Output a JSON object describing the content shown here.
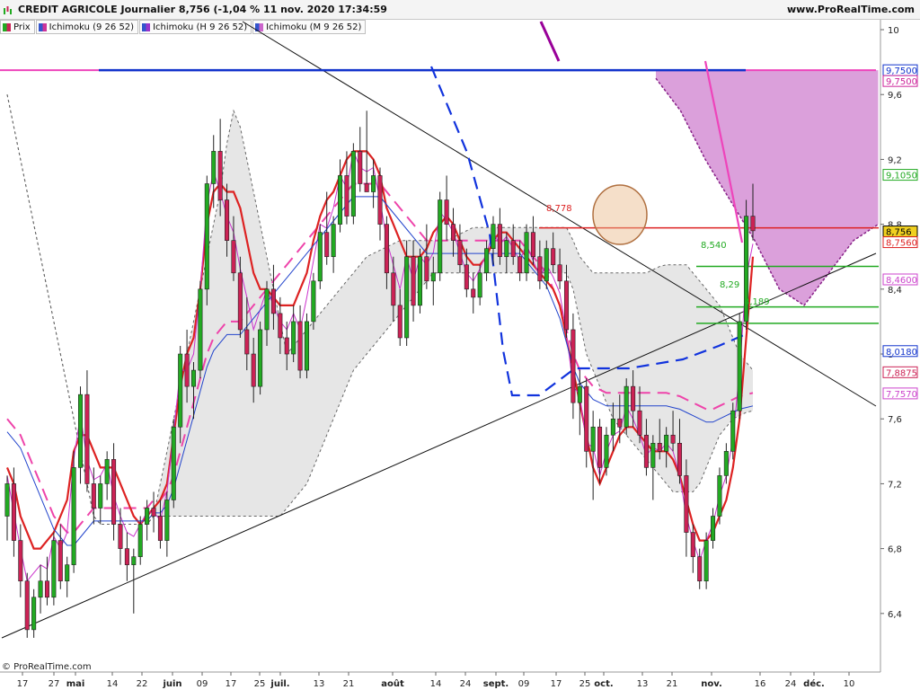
{
  "header": {
    "title": "CREDIT AGRICOLE Journalier 8,756 (-1,04 % 11 nov. 2020 17:34:59",
    "site": "www.ProRealTime.com"
  },
  "legend": [
    {
      "label": "Prix",
      "color": "#2ca02c"
    },
    {
      "label": "Ichimoku (9 26 52)",
      "color": "#cc3399"
    },
    {
      "label": "Ichimoku (H 9 26 52)",
      "color": "#9933cc"
    },
    {
      "label": "Ichimoku (M 9 26 52)",
      "color": "#3355cc"
    }
  ],
  "footer": {
    "copyright": "© ProRealTime.com"
  },
  "colors": {
    "up": "#22aa22",
    "down": "#cc2255",
    "tenkan": "#dd2222",
    "kijun_dash": "#ee44aa",
    "weekly_kijun": "#1133dd",
    "cloud": "#dddddd",
    "cloud_purple": "#cc77cc"
  },
  "chart_data": {
    "type": "candlestick",
    "y_axis": {
      "range": [
        6.05,
        10.05
      ],
      "ticks": [
        "10",
        "9,6",
        "9,2",
        "8,8",
        "8,4",
        "8",
        "7,6",
        "7,2",
        "6,8",
        "6,4"
      ]
    },
    "x_axis": {
      "labels": [
        "17",
        "27",
        "mai",
        "14",
        "22",
        "juin",
        "09",
        "17",
        "25",
        "juil.",
        "13",
        "21",
        "août",
        "14",
        "24",
        "sept.",
        "09",
        "17",
        "25",
        "oct.",
        "13",
        "21",
        "nov.",
        "16",
        "24",
        "déc.",
        "10"
      ]
    },
    "price_labels": [
      {
        "value": 9.75,
        "text": "9,7500",
        "color": "#1133cc"
      },
      {
        "value": 9.75,
        "text": "9,7500",
        "color": "#cc2299"
      },
      {
        "value": 9.105,
        "text": "9,1050",
        "color": "#22aa22"
      },
      {
        "value": 8.756,
        "text": "8,756",
        "color": "#000000"
      },
      {
        "value": 8.756,
        "text": "8,7560",
        "color": "#dd2222"
      },
      {
        "value": 8.46,
        "text": "8,4600",
        "color": "#cc44cc"
      },
      {
        "value": 8.018,
        "text": "8,0180",
        "color": "#1133cc"
      },
      {
        "value": 7.8875,
        "text": "7,8875",
        "color": "#cc2255"
      },
      {
        "value": 7.757,
        "text": "7,7570",
        "color": "#cc44cc"
      }
    ],
    "annotations": [
      {
        "text": "8,778",
        "value": 8.778,
        "color": "#dd2222"
      },
      {
        "text": "8,540",
        "value": 8.54,
        "color": "#22aa22"
      },
      {
        "text": "8,29",
        "value": 8.29,
        "color": "#22aa22"
      },
      {
        "text": "8,189",
        "value": 8.189,
        "color": "#22aa22"
      }
    ],
    "candles": [
      [
        7.0,
        7.25,
        6.85,
        7.2
      ],
      [
        7.2,
        7.3,
        6.75,
        6.85
      ],
      [
        6.85,
        6.95,
        6.5,
        6.6
      ],
      [
        6.6,
        6.65,
        6.25,
        6.3
      ],
      [
        6.3,
        6.55,
        6.25,
        6.5
      ],
      [
        6.5,
        6.7,
        6.4,
        6.6
      ],
      [
        6.6,
        6.75,
        6.45,
        6.5
      ],
      [
        6.5,
        6.9,
        6.45,
        6.85
      ],
      [
        6.85,
        6.95,
        6.55,
        6.6
      ],
      [
        6.6,
        6.75,
        6.5,
        6.7
      ],
      [
        6.7,
        7.4,
        6.65,
        7.3
      ],
      [
        7.3,
        7.8,
        7.2,
        7.75
      ],
      [
        7.75,
        7.9,
        7.15,
        7.2
      ],
      [
        7.2,
        7.3,
        6.95,
        7.05
      ],
      [
        7.05,
        7.25,
        6.95,
        7.2
      ],
      [
        7.2,
        7.4,
        7.1,
        7.35
      ],
      [
        7.35,
        7.45,
        6.85,
        6.95
      ],
      [
        6.95,
        7.05,
        6.7,
        6.8
      ],
      [
        6.8,
        6.9,
        6.6,
        6.7
      ],
      [
        6.7,
        6.8,
        6.4,
        6.75
      ],
      [
        6.75,
        7.0,
        6.7,
        6.95
      ],
      [
        6.95,
        7.1,
        6.85,
        7.05
      ],
      [
        7.05,
        7.15,
        6.9,
        7.0
      ],
      [
        7.0,
        7.1,
        6.8,
        6.85
      ],
      [
        6.85,
        7.15,
        6.75,
        7.1
      ],
      [
        7.1,
        7.6,
        7.05,
        7.55
      ],
      [
        7.55,
        8.05,
        7.45,
        8.0
      ],
      [
        8.0,
        8.15,
        7.7,
        7.8
      ],
      [
        7.8,
        7.95,
        7.6,
        7.9
      ],
      [
        7.9,
        8.45,
        7.85,
        8.4
      ],
      [
        8.4,
        9.1,
        8.3,
        9.05
      ],
      [
        9.05,
        9.35,
        8.9,
        9.25
      ],
      [
        9.25,
        9.45,
        8.85,
        8.95
      ],
      [
        8.95,
        9.05,
        8.6,
        8.7
      ],
      [
        8.7,
        8.85,
        8.45,
        8.5
      ],
      [
        8.5,
        8.6,
        8.1,
        8.15
      ],
      [
        8.15,
        8.35,
        7.9,
        8.0
      ],
      [
        8.0,
        8.1,
        7.7,
        7.8
      ],
      [
        7.8,
        8.2,
        7.75,
        8.15
      ],
      [
        8.15,
        8.45,
        8.05,
        8.4
      ],
      [
        8.4,
        8.55,
        8.15,
        8.25
      ],
      [
        8.25,
        8.35,
        8.0,
        8.1
      ],
      [
        8.1,
        8.2,
        7.9,
        8.0
      ],
      [
        8.0,
        8.3,
        7.95,
        8.2
      ],
      [
        8.2,
        8.3,
        7.85,
        7.9
      ],
      [
        7.9,
        8.25,
        7.85,
        8.2
      ],
      [
        8.2,
        8.5,
        8.15,
        8.45
      ],
      [
        8.45,
        8.8,
        8.4,
        8.75
      ],
      [
        8.75,
        9.0,
        8.55,
        8.6
      ],
      [
        8.6,
        8.85,
        8.5,
        8.8
      ],
      [
        8.8,
        9.2,
        8.75,
        9.1
      ],
      [
        9.1,
        9.25,
        8.8,
        8.85
      ],
      [
        8.85,
        9.3,
        8.8,
        9.25
      ],
      [
        9.25,
        9.4,
        9.0,
        9.05
      ],
      [
        9.05,
        9.5,
        9.0,
        9.0
      ],
      [
        9.0,
        9.2,
        8.9,
        9.1
      ],
      [
        9.1,
        9.15,
        8.7,
        8.8
      ],
      [
        8.8,
        8.85,
        8.4,
        8.5
      ],
      [
        8.5,
        8.6,
        8.2,
        8.3
      ],
      [
        8.3,
        8.4,
        8.05,
        8.1
      ],
      [
        8.1,
        8.7,
        8.05,
        8.6
      ],
      [
        8.6,
        8.7,
        8.2,
        8.3
      ],
      [
        8.3,
        8.65,
        8.25,
        8.6
      ],
      [
        8.6,
        8.8,
        8.4,
        8.45
      ],
      [
        8.45,
        8.6,
        8.3,
        8.5
      ],
      [
        8.5,
        9.0,
        8.45,
        8.95
      ],
      [
        8.95,
        9.1,
        8.7,
        8.8
      ],
      [
        8.8,
        8.9,
        8.6,
        8.7
      ],
      [
        8.7,
        8.8,
        8.5,
        8.55
      ],
      [
        8.55,
        8.65,
        8.35,
        8.4
      ],
      [
        8.4,
        8.5,
        8.25,
        8.35
      ],
      [
        8.35,
        8.55,
        8.3,
        8.5
      ],
      [
        8.5,
        8.7,
        8.45,
        8.65
      ],
      [
        8.65,
        8.85,
        8.55,
        8.8
      ],
      [
        8.8,
        8.9,
        8.55,
        8.6
      ],
      [
        8.6,
        8.75,
        8.5,
        8.7
      ],
      [
        8.7,
        8.8,
        8.55,
        8.6
      ],
      [
        8.6,
        8.7,
        8.45,
        8.5
      ],
      [
        8.5,
        8.8,
        8.45,
        8.75
      ],
      [
        8.75,
        8.85,
        8.55,
        8.6
      ],
      [
        8.6,
        8.7,
        8.4,
        8.45
      ],
      [
        8.45,
        8.7,
        8.4,
        8.65
      ],
      [
        8.65,
        8.75,
        8.5,
        8.55
      ],
      [
        8.55,
        8.65,
        8.4,
        8.45
      ],
      [
        8.45,
        8.55,
        8.1,
        8.15
      ],
      [
        8.15,
        8.25,
        7.6,
        7.7
      ],
      [
        7.7,
        7.9,
        7.5,
        7.8
      ],
      [
        7.8,
        7.85,
        7.3,
        7.4
      ],
      [
        7.4,
        7.65,
        7.1,
        7.55
      ],
      [
        7.55,
        7.6,
        7.2,
        7.3
      ],
      [
        7.3,
        7.55,
        7.25,
        7.5
      ],
      [
        7.5,
        7.7,
        7.4,
        7.6
      ],
      [
        7.6,
        7.75,
        7.45,
        7.55
      ],
      [
        7.55,
        7.85,
        7.5,
        7.8
      ],
      [
        7.8,
        7.9,
        7.55,
        7.65
      ],
      [
        7.65,
        7.8,
        7.45,
        7.5
      ],
      [
        7.5,
        7.6,
        7.25,
        7.3
      ],
      [
        7.3,
        7.5,
        7.1,
        7.45
      ],
      [
        7.45,
        7.6,
        7.35,
        7.4
      ],
      [
        7.4,
        7.55,
        7.3,
        7.5
      ],
      [
        7.5,
        7.65,
        7.4,
        7.45
      ],
      [
        7.45,
        7.6,
        7.2,
        7.25
      ],
      [
        7.25,
        7.35,
        6.75,
        6.9
      ],
      [
        6.9,
        6.95,
        6.65,
        6.75
      ],
      [
        6.75,
        6.8,
        6.55,
        6.6
      ],
      [
        6.6,
        6.9,
        6.55,
        6.85
      ],
      [
        6.85,
        7.05,
        6.8,
        7.0
      ],
      [
        7.0,
        7.3,
        6.95,
        7.25
      ],
      [
        7.25,
        7.45,
        7.2,
        7.4
      ],
      [
        7.4,
        7.7,
        7.35,
        7.65
      ],
      [
        7.65,
        8.25,
        7.6,
        8.2
      ],
      [
        8.2,
        8.95,
        8.15,
        8.85
      ],
      [
        8.85,
        9.05,
        8.7,
        8.76
      ]
    ],
    "tenkan": [
      7.3,
      7.2,
      7.0,
      6.9,
      6.8,
      6.8,
      6.85,
      6.9,
      7.0,
      7.1,
      7.4,
      7.5,
      7.5,
      7.4,
      7.3,
      7.3,
      7.3,
      7.2,
      7.1,
      7.0,
      6.95,
      7.0,
      7.05,
      7.1,
      7.2,
      7.5,
      7.8,
      8.0,
      8.1,
      8.4,
      8.8,
      9.0,
      9.05,
      9.0,
      9.0,
      8.9,
      8.7,
      8.5,
      8.4,
      8.4,
      8.35,
      8.3,
      8.3,
      8.3,
      8.4,
      8.5,
      8.7,
      8.85,
      8.95,
      9.0,
      9.1,
      9.2,
      9.25,
      9.25,
      9.25,
      9.2,
      9.1,
      8.9,
      8.8,
      8.7,
      8.6,
      8.6,
      8.6,
      8.65,
      8.75,
      8.8,
      8.85,
      8.8,
      8.7,
      8.6,
      8.55,
      8.55,
      8.6,
      8.7,
      8.75,
      8.75,
      8.7,
      8.65,
      8.6,
      8.55,
      8.5,
      8.45,
      8.4,
      8.3,
      8.1,
      7.9,
      7.7,
      7.5,
      7.3,
      7.2,
      7.3,
      7.4,
      7.5,
      7.55,
      7.55,
      7.5,
      7.45,
      7.4,
      7.4,
      7.4,
      7.35,
      7.25,
      7.1,
      6.95,
      6.85,
      6.85,
      6.9,
      7.0,
      7.1,
      7.3,
      7.6,
      8.1,
      8.6
    ],
    "kijun": [
      7.6,
      7.55,
      7.5,
      7.4,
      7.3,
      7.2,
      7.1,
      7.0,
      6.95,
      6.9,
      6.9,
      6.95,
      7.0,
      7.05,
      7.05,
      7.05,
      7.05,
      7.05,
      7.05,
      7.05,
      7.05,
      7.05,
      7.1,
      7.1,
      7.15,
      7.25,
      7.4,
      7.55,
      7.7,
      7.85,
      8.0,
      8.1,
      8.15,
      8.2,
      8.2,
      8.2,
      8.25,
      8.3,
      8.35,
      8.4,
      8.45,
      8.5,
      8.55,
      8.6,
      8.65,
      8.7,
      8.75,
      8.8,
      8.85,
      8.9,
      8.95,
      9.0,
      9.05,
      9.05,
      9.05,
      9.05,
      9.05,
      9.0,
      8.95,
      8.9,
      8.85,
      8.8,
      8.75,
      8.7,
      8.7,
      8.7,
      8.7,
      8.7,
      8.7,
      8.7,
      8.7,
      8.7,
      8.7,
      8.7,
      8.7,
      8.7,
      8.7,
      8.7,
      8.65,
      8.6,
      8.55,
      8.5,
      8.4,
      8.3,
      8.15,
      8.0,
      7.9,
      7.85,
      7.8,
      7.78,
      7.76,
      7.76,
      7.76,
      7.76,
      7.76,
      7.76,
      7.76,
      7.76,
      7.76,
      7.76,
      7.75,
      7.74,
      7.72,
      7.7,
      7.68,
      7.66,
      7.66,
      7.68,
      7.7,
      7.72,
      7.74,
      7.75,
      7.76
    ],
    "weekly_kijun": [
      9.75,
      9.75,
      9.75,
      9.75,
      9.75,
      9.75,
      9.75,
      9.75,
      9.75,
      9.75,
      9.75,
      9.75,
      9.75,
      9.75,
      9.75,
      9.75,
      9.75,
      9.75,
      9.75,
      9.75,
      9.75,
      9.75,
      9.75,
      9.75,
      9.75,
      9.75,
      9.75,
      9.75,
      9.75,
      9.75,
      9.75,
      9.75,
      9.75,
      9.75,
      9.75,
      9.75,
      9.75,
      9.75,
      9.75,
      9.75,
      9.75,
      9.75,
      9.75,
      9.75,
      9.75,
      9.75,
      9.75,
      9.75,
      9.75,
      9.75,
      9.75,
      9.75,
      9.75,
      9.75,
      9.75,
      9.75,
      9.75,
      9.75,
      9.75,
      9.75,
      9.75,
      9.75,
      9.75,
      9.75,
      9.75,
      9.75,
      9.75,
      9.75,
      9.75,
      9.75,
      9.75,
      9.75,
      9.75,
      9.75,
      9.75,
      9.75,
      9.75,
      9.75,
      9.75,
      9.75,
      9.75,
      9.75,
      9.75,
      9.75,
      9.75,
      9.75,
      9.75,
      9.75,
      9.75,
      9.75,
      9.75,
      9.75,
      9.75,
      9.75,
      9.75,
      9.75,
      9.75,
      9.75,
      9.75,
      9.75,
      9.75,
      9.75,
      9.75,
      9.75,
      9.75,
      9.75,
      9.75,
      9.75,
      9.75,
      9.75,
      9.75,
      9.75,
      9.75
    ],
    "cloud_upper": [
      9.6,
      9.4,
      9.2,
      9.0,
      8.8,
      8.6,
      8.4,
      8.2,
      8.0,
      7.8,
      7.6,
      7.4,
      7.2,
      7.0,
      6.95,
      6.95,
      6.95,
      6.95,
      6.95,
      6.95,
      6.95,
      6.95,
      7.0,
      7.2,
      7.4,
      7.6,
      7.8,
      8.0,
      8.2,
      8.4,
      8.6,
      8.8,
      9.0,
      9.3,
      9.5,
      9.4,
      9.2,
      9.0,
      8.8,
      8.6,
      8.4,
      8.2,
      8.0,
      8.05,
      8.1,
      8.15,
      8.2,
      8.25,
      8.3,
      8.35,
      8.4,
      8.45,
      8.5,
      8.55,
      8.6,
      8.62,
      8.64,
      8.66,
      8.68,
      8.7,
      8.7,
      8.7,
      8.7,
      8.7,
      8.7,
      8.7,
      8.7,
      8.72,
      8.74,
      8.76,
      8.78,
      8.78,
      8.78,
      8.78,
      8.78,
      8.78,
      8.78,
      8.78,
      8.78,
      8.78,
      8.78,
      8.78,
      8.78,
      8.78,
      8.78,
      8.7,
      8.6,
      8.55,
      8.5,
      8.5,
      8.5,
      8.5,
      8.5,
      8.5,
      8.5,
      8.5,
      8.5,
      8.52,
      8.54,
      8.55,
      8.55,
      8.55,
      8.55,
      8.5,
      8.45,
      8.4,
      8.35,
      8.3,
      8.2,
      8.1,
      8.0,
      7.95,
      7.9
    ],
    "cloud_lower": [
      9.6,
      9.4,
      9.2,
      9.0,
      8.8,
      8.6,
      8.4,
      8.2,
      8.0,
      7.8,
      7.6,
      7.4,
      7.2,
      7.0,
      6.95,
      6.95,
      6.95,
      6.95,
      6.95,
      6.95,
      6.95,
      6.95,
      7.0,
      7.0,
      7.0,
      7.0,
      7.0,
      7.0,
      7.0,
      7.0,
      7.0,
      7.0,
      7.0,
      7.0,
      7.0,
      7.0,
      7.0,
      7.0,
      7.0,
      7.0,
      7.0,
      7.0,
      7.05,
      7.1,
      7.15,
      7.2,
      7.3,
      7.4,
      7.5,
      7.6,
      7.7,
      7.8,
      7.9,
      7.95,
      8.0,
      8.05,
      8.1,
      8.15,
      8.2,
      8.25,
      8.3,
      8.35,
      8.4,
      8.45,
      8.5,
      8.5,
      8.5,
      8.5,
      8.5,
      8.5,
      8.5,
      8.5,
      8.5,
      8.5,
      8.5,
      8.5,
      8.5,
      8.5,
      8.5,
      8.5,
      8.5,
      8.5,
      8.5,
      8.5,
      8.5,
      8.4,
      8.2,
      8.0,
      7.9,
      7.8,
      7.7,
      7.6,
      7.55,
      7.5,
      7.45,
      7.4,
      7.35,
      7.3,
      7.25,
      7.2,
      7.15,
      7.15,
      7.15,
      7.15,
      7.2,
      7.3,
      7.4,
      7.5,
      7.55,
      7.6,
      7.62,
      7.64,
      7.65
    ]
  }
}
